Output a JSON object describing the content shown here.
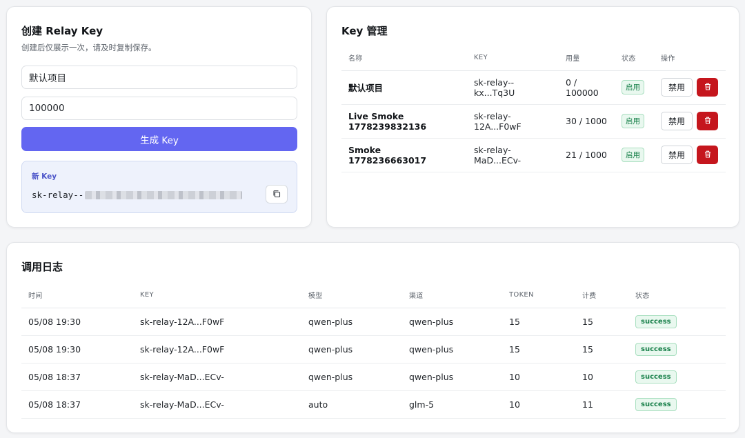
{
  "create": {
    "title": "创建 Relay Key",
    "subtitle": "创建后仅展示一次，请及时复制保存。",
    "name_value": "默认项目",
    "quota_value": "100000",
    "generate_label": "生成 Key",
    "new_key_label": "新 Key",
    "new_key_prefix": "sk-relay--"
  },
  "keys": {
    "title": "Key 管理",
    "columns": [
      "名称",
      "KEY",
      "用量",
      "状态",
      "操作"
    ],
    "rows": [
      {
        "name": "默认项目",
        "key": "sk-relay--kx...Tq3U",
        "usage": "0 / 100000",
        "status": "启用",
        "action": "禁用"
      },
      {
        "name": "Live Smoke 1778239832136",
        "key": "sk-relay-12A...F0wF",
        "usage": "30 / 1000",
        "status": "启用",
        "action": "禁用"
      },
      {
        "name": "Smoke 1778236663017",
        "key": "sk-relay-MaD...ECv-",
        "usage": "21 / 1000",
        "status": "启用",
        "action": "禁用"
      }
    ]
  },
  "logs": {
    "title": "调用日志",
    "columns": [
      "时间",
      "KEY",
      "模型",
      "渠道",
      "TOKEN",
      "计费",
      "状态"
    ],
    "rows": [
      {
        "time": "05/08 19:30",
        "key": "sk-relay-12A...F0wF",
        "model": "qwen-plus",
        "channel": "qwen-plus",
        "token": "15",
        "cost": "15",
        "status": "success"
      },
      {
        "time": "05/08 19:30",
        "key": "sk-relay-12A...F0wF",
        "model": "qwen-plus",
        "channel": "qwen-plus",
        "token": "15",
        "cost": "15",
        "status": "success"
      },
      {
        "time": "05/08 18:37",
        "key": "sk-relay-MaD...ECv-",
        "model": "qwen-plus",
        "channel": "qwen-plus",
        "token": "10",
        "cost": "10",
        "status": "success"
      },
      {
        "time": "05/08 18:37",
        "key": "sk-relay-MaD...ECv-",
        "model": "auto",
        "channel": "glm-5",
        "token": "10",
        "cost": "11",
        "status": "success"
      }
    ]
  },
  "icons": {
    "copy": "copy-icon",
    "delete": "trash-icon"
  },
  "colors": {
    "primary": "#6366f1",
    "danger": "#c5161d",
    "success": "#18804a"
  }
}
